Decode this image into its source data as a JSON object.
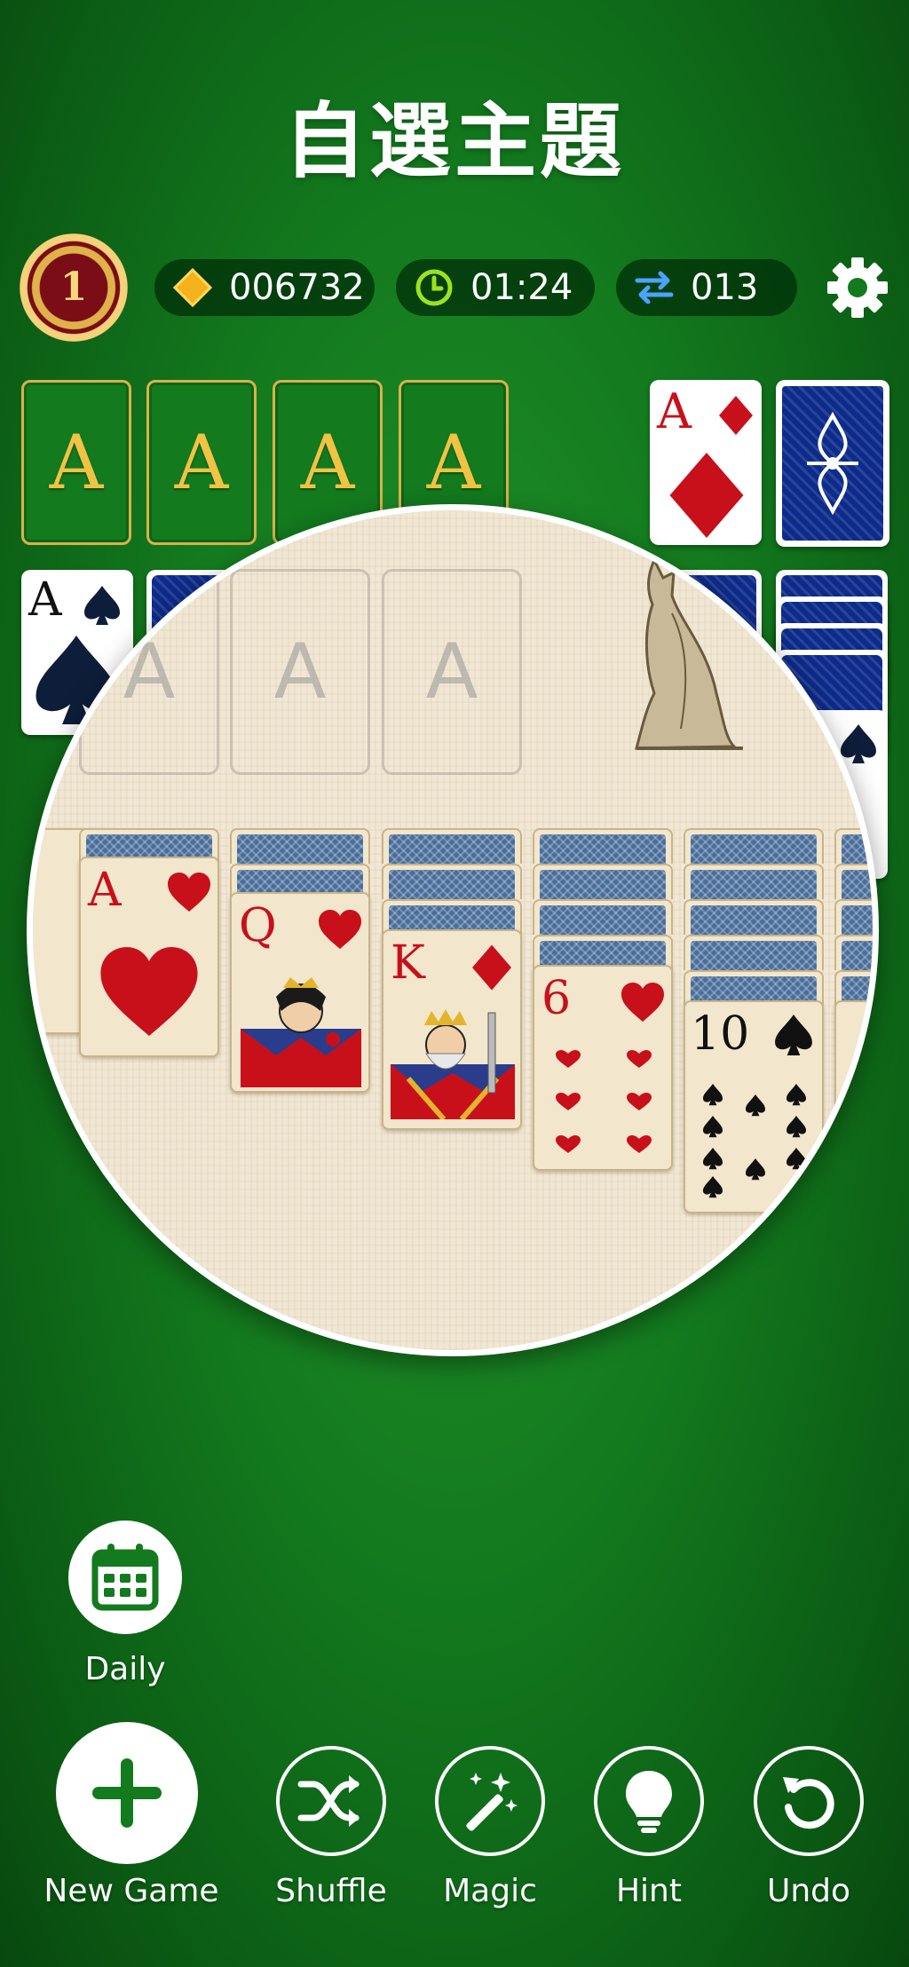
{
  "header": {
    "title": "自選主題"
  },
  "status": {
    "level": "1",
    "coins": "006732",
    "time": "01:24",
    "moves": "013"
  },
  "foundations": [
    "A",
    "A",
    "A",
    "A"
  ],
  "preview": {
    "slots": [
      "A",
      "A",
      "A"
    ],
    "cards": [
      {
        "rank": "A",
        "suit": "hearts"
      },
      {
        "rank": "Q",
        "suit": "hearts"
      },
      {
        "rank": "K",
        "suit": "diamonds"
      },
      {
        "rank": "6",
        "suit": "hearts"
      },
      {
        "rank": "10",
        "suit": "spades"
      }
    ]
  },
  "waste_card": {
    "rank": "A",
    "suit": "diamonds"
  },
  "tableau_first": {
    "rank": "A",
    "suit": "spades"
  },
  "daily": {
    "label": "Daily",
    "icon": "calendar-icon"
  },
  "toolbar": {
    "new_game": "New Game",
    "shuffle": "Shuffle",
    "magic": "Magic",
    "hint": "Hint",
    "undo": "Undo"
  },
  "colors": {
    "felt": "#137a1e",
    "gold": "#f0c344",
    "red_suit": "#c8101a",
    "card_back": "#0d2b8a"
  }
}
